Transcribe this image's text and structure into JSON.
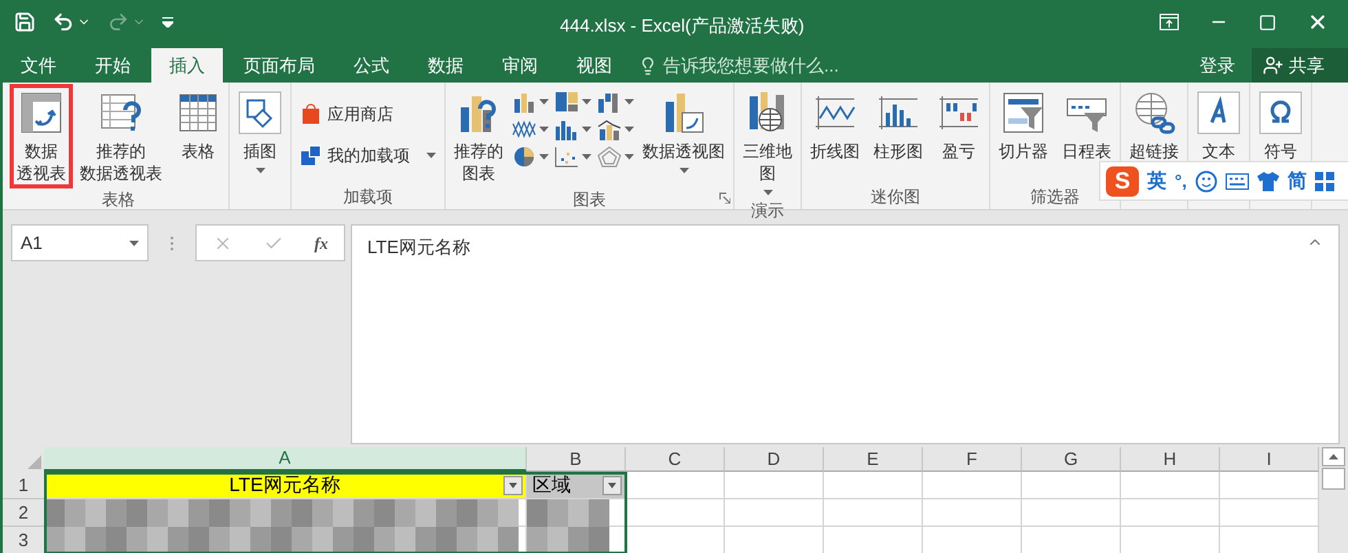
{
  "window": {
    "title": "444.xlsx - Excel(产品激活失败)"
  },
  "tabs": [
    {
      "label": "文件",
      "selected": false
    },
    {
      "label": "开始",
      "selected": false
    },
    {
      "label": "插入",
      "selected": true
    },
    {
      "label": "页面布局",
      "selected": false
    },
    {
      "label": "公式",
      "selected": false
    },
    {
      "label": "数据",
      "selected": false
    },
    {
      "label": "审阅",
      "selected": false
    },
    {
      "label": "视图",
      "selected": false
    }
  ],
  "tell_me": {
    "placeholder": "告诉我您想要做什么..."
  },
  "account": {
    "sign_in": "登录",
    "share": "共享"
  },
  "ribbon": {
    "groups": [
      {
        "label": "表格",
        "items": [
          {
            "kind": "large",
            "lines": [
              "数据",
              "透视表"
            ],
            "menu": false,
            "highlighted": true
          },
          {
            "kind": "large",
            "lines": [
              "推荐的",
              "数据透视表"
            ],
            "menu": false,
            "highlighted": false
          },
          {
            "kind": "large",
            "lines": [
              "表格"
            ],
            "menu": false,
            "highlighted": false
          }
        ]
      },
      {
        "items": [
          {
            "kind": "large",
            "lines": [
              "插图"
            ],
            "menu": true,
            "highlighted": false
          }
        ]
      },
      {
        "label": "加载项",
        "items": [
          {
            "kind": "small",
            "lines": [
              "应用商店"
            ],
            "menu": false
          },
          {
            "kind": "small",
            "lines": [
              "我的加载项"
            ],
            "menu": true
          }
        ]
      },
      {
        "label": "图表",
        "launcher": true,
        "items": [
          {
            "kind": "large",
            "lines": [
              "推荐的",
              "图表"
            ],
            "menu": false,
            "highlighted": false
          },
          {
            "kind": "chart_grid"
          },
          {
            "kind": "large",
            "lines": [
              "数据透视图"
            ],
            "menu": true,
            "highlighted": false
          }
        ]
      },
      {
        "label": "演示",
        "items": [
          {
            "kind": "large",
            "lines": [
              "三维地",
              "图"
            ],
            "menu": true,
            "highlighted": false
          }
        ]
      },
      {
        "label": "迷你图",
        "items": [
          {
            "kind": "large",
            "lines": [
              "折线图"
            ],
            "menu": false,
            "highlighted": false
          },
          {
            "kind": "large",
            "lines": [
              "柱形图"
            ],
            "menu": false,
            "highlighted": false
          },
          {
            "kind": "large",
            "lines": [
              "盈亏"
            ],
            "menu": false,
            "highlighted": false
          }
        ]
      },
      {
        "label": "筛选器",
        "items": [
          {
            "kind": "large",
            "lines": [
              "切片器"
            ],
            "menu": false,
            "highlighted": false
          },
          {
            "kind": "large",
            "lines": [
              "日程表"
            ],
            "menu": false,
            "highlighted": false
          }
        ]
      },
      {
        "items": [
          {
            "kind": "large",
            "lines": [
              "超链接"
            ],
            "menu": false,
            "highlighted": false
          }
        ]
      },
      {
        "items": [
          {
            "kind": "large",
            "lines": [
              "文本"
            ],
            "menu": false,
            "highlighted": false
          }
        ]
      },
      {
        "items": [
          {
            "kind": "large",
            "lines": [
              "符号"
            ],
            "menu": false,
            "highlighted": false
          }
        ]
      }
    ]
  },
  "ime_bar": {
    "logo": "S",
    "mode": "英",
    "punctuation": "°,",
    "script": "简"
  },
  "formula_bar": {
    "name_box": "A1",
    "fx": "fx",
    "value": "LTE网元名称"
  },
  "sheet": {
    "columns": [
      {
        "label": "A",
        "selected": true
      },
      {
        "label": "B",
        "selected": false
      },
      {
        "label": "C",
        "selected": false
      },
      {
        "label": "D",
        "selected": false
      },
      {
        "label": "E",
        "selected": false
      },
      {
        "label": "F",
        "selected": false
      },
      {
        "label": "G",
        "selected": false
      },
      {
        "label": "H",
        "selected": false
      },
      {
        "label": "I",
        "selected": false
      }
    ],
    "rows": [
      {
        "header": "1",
        "cells": [
          {
            "kind": "header",
            "text": "LTE网元名称",
            "color": "#ffff00",
            "filter": true
          },
          {
            "kind": "header",
            "text": "区域",
            "color": "#c6c6c6",
            "filter": true
          }
        ]
      },
      {
        "header": "2",
        "cells": [
          {
            "kind": "blurred"
          },
          {
            "kind": "blurred"
          }
        ]
      },
      {
        "header": "3",
        "cells": [
          {
            "kind": "blurred"
          },
          {
            "kind": "blurred"
          }
        ]
      }
    ]
  }
}
